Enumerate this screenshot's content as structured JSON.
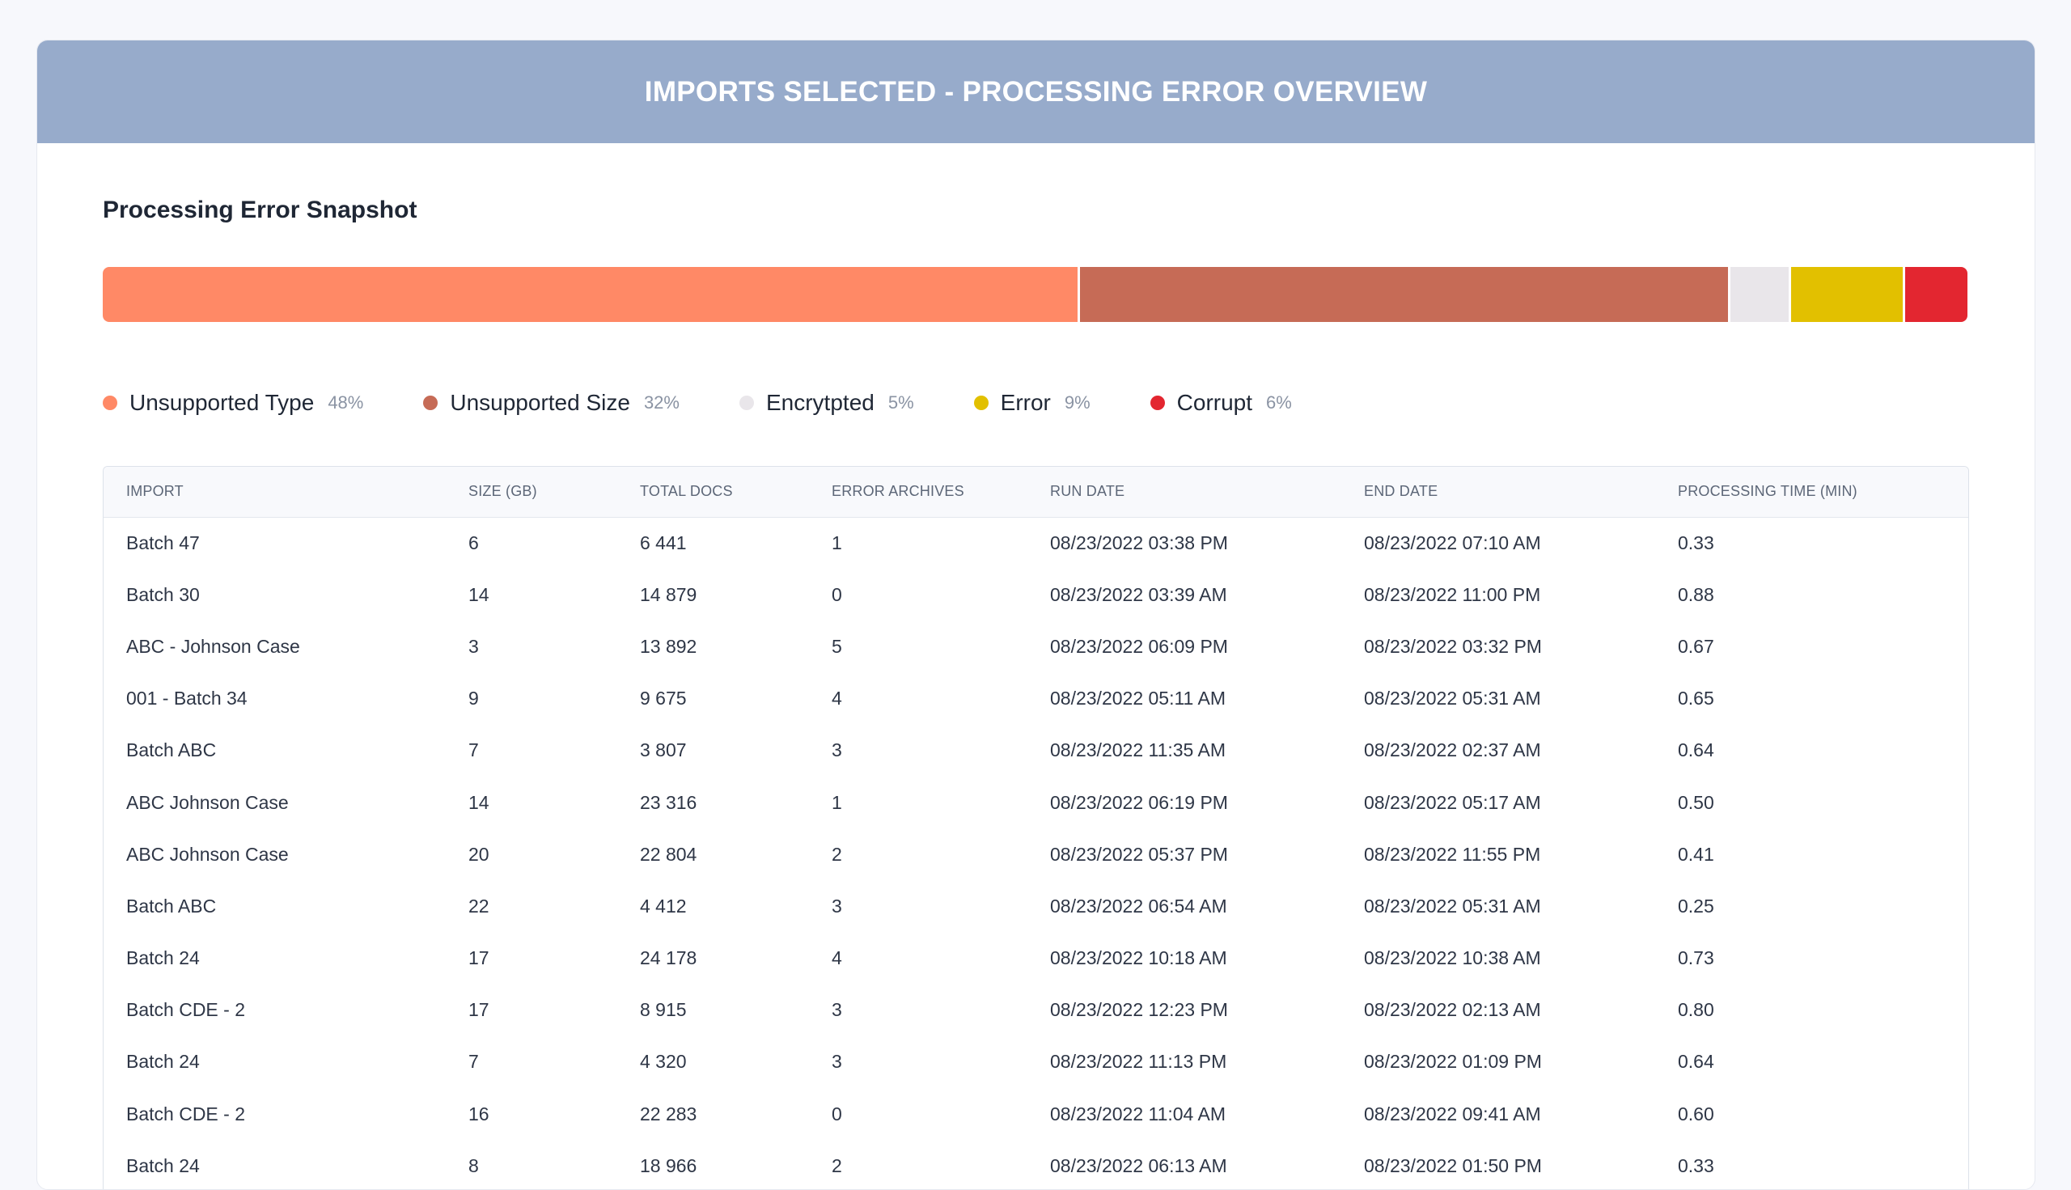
{
  "header": {
    "title": "IMPORTS SELECTED - PROCESSING ERROR OVERVIEW"
  },
  "snapshot": {
    "title": "Processing Error Snapshot",
    "segments": [
      {
        "label": "Unsupported Type",
        "pct": "48%",
        "value": 48,
        "color": "#ff8966"
      },
      {
        "label": "Unsupported Size",
        "pct": "32%",
        "value": 32,
        "color": "#c66b56"
      },
      {
        "label": "Encrytpted",
        "pct": "5%",
        "value": 3,
        "color": "#e9e6ea"
      },
      {
        "label": "Error",
        "pct": "9%",
        "value": 5.6,
        "color": "#e2c000"
      },
      {
        "label": "Corrupt",
        "pct": "6%",
        "value": 3.2,
        "color": "#e32630"
      }
    ]
  },
  "table": {
    "columns": [
      "IMPORT",
      "SIZE (GB)",
      "TOTAL DOCS",
      "ERROR ARCHIVES",
      "RUN DATE",
      "END DATE",
      "PROCESSING TIME (MIN)"
    ],
    "rows": [
      [
        "Batch 47",
        "6",
        "6 441",
        "1",
        "08/23/2022 03:38 PM",
        "08/23/2022 07:10 AM",
        "0.33"
      ],
      [
        "Batch 30",
        "14",
        "14 879",
        "0",
        "08/23/2022 03:39 AM",
        "08/23/2022 11:00 PM",
        "0.88"
      ],
      [
        "ABC - Johnson Case",
        "3",
        "13 892",
        "5",
        "08/23/2022 06:09 PM",
        "08/23/2022 03:32 PM",
        "0.67"
      ],
      [
        "001 - Batch 34",
        "9",
        "9 675",
        "4",
        "08/23/2022 05:11 AM",
        "08/23/2022 05:31 AM",
        "0.65"
      ],
      [
        "Batch ABC",
        "7",
        "3 807",
        "3",
        "08/23/2022 11:35 AM",
        "08/23/2022 02:37 AM",
        "0.64"
      ],
      [
        "ABC Johnson Case",
        "14",
        "23 316",
        "1",
        "08/23/2022 06:19 PM",
        "08/23/2022 05:17 AM",
        "0.50"
      ],
      [
        "ABC Johnson Case",
        "20",
        "22 804",
        "2",
        "08/23/2022 05:37 PM",
        "08/23/2022 11:55 PM",
        "0.41"
      ],
      [
        "Batch ABC",
        "22",
        "4 412",
        "3",
        "08/23/2022 06:54 AM",
        "08/23/2022 05:31 AM",
        "0.25"
      ],
      [
        "Batch 24",
        "17",
        "24 178",
        "4",
        "08/23/2022 10:18 AM",
        "08/23/2022 10:38 AM",
        "0.73"
      ],
      [
        "Batch CDE - 2",
        "17",
        "8 915",
        "3",
        "08/23/2022 12:23 PM",
        "08/23/2022 02:13 AM",
        "0.80"
      ],
      [
        "Batch 24",
        "7",
        "4 320",
        "3",
        "08/23/2022 11:13 PM",
        "08/23/2022 01:09 PM",
        "0.64"
      ],
      [
        "Batch CDE - 2",
        "16",
        "22 283",
        "0",
        "08/23/2022 11:04 AM",
        "08/23/2022 09:41 AM",
        "0.60"
      ],
      [
        "Batch 24",
        "8",
        "18 966",
        "2",
        "08/23/2022 06:13 AM",
        "08/23/2022 01:50 PM",
        "0.33"
      ]
    ]
  }
}
